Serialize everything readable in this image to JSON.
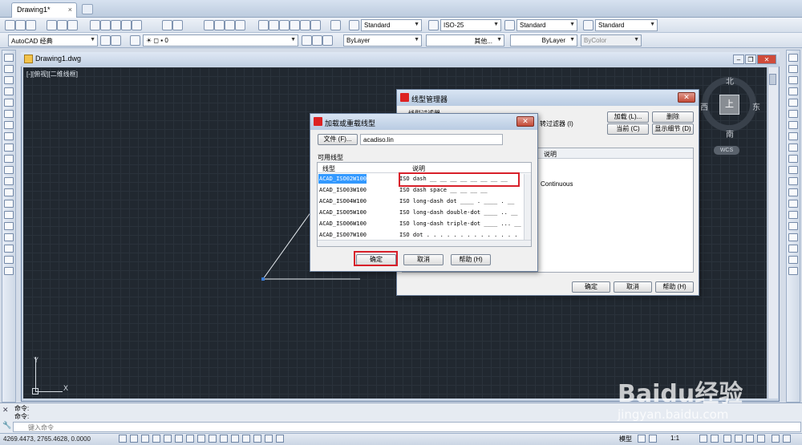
{
  "tabs": {
    "doc_tab": "Drawing1*",
    "close": "×"
  },
  "toolbar": {
    "text_style": "Standard",
    "dim_style": "ISO-25",
    "table_style": "Standard",
    "mleader_style": "Standard",
    "workspace": "AutoCAD 经典",
    "layer_value": "0",
    "color_value": "ByLayer",
    "linetype_value": "其他...",
    "lineweight_value": "ByLayer",
    "plotstyle_value": "ByColor"
  },
  "drawing": {
    "title": "Drawing1.dwg",
    "view_label": "[-][俯视][二维线框]",
    "viewcube": {
      "north": "北",
      "south": "南",
      "east": "东",
      "west": "西",
      "top": "上",
      "wcs": "WCS"
    },
    "ucs": {
      "x": "X",
      "y": "Y"
    }
  },
  "ltm": {
    "title": "线型管理器",
    "filter_label": "线型过滤器",
    "filter_suffix": "转过滤器 (I)",
    "load_button": "加载 (L)...",
    "delete_button": "删除",
    "current_button": "当前 (C)",
    "details_button": "显示细节 (D)",
    "desc_header": "说明",
    "continuous": "Continuous",
    "ok": "确定",
    "cancel": "取消",
    "help": "帮助 (H)"
  },
  "load": {
    "title": "加载或重载线型",
    "file_button": "文件 (F)...",
    "file_value": "acadiso.lin",
    "available": "可用线型",
    "col_linetype": "线型",
    "col_desc": "说明",
    "rows": [
      {
        "name": "ACAD_ISO02W100",
        "desc": "ISO dash __ __ __ __ __ __ __ __"
      },
      {
        "name": "ACAD_ISO03W100",
        "desc": "ISO dash space __   __   __   __"
      },
      {
        "name": "ACAD_ISO04W100",
        "desc": "ISO long-dash dot ____ . ____ . __"
      },
      {
        "name": "ACAD_ISO05W100",
        "desc": "ISO long-dash double-dot ____ .. __"
      },
      {
        "name": "ACAD_ISO06W100",
        "desc": "ISO long-dash triple-dot ____ ... __"
      },
      {
        "name": "ACAD_ISO07W100",
        "desc": "ISO dot . . . . . . . . . . . . . ."
      }
    ],
    "ok": "确定",
    "cancel": "取消",
    "help": "帮助 (H)"
  },
  "command": {
    "line1": "命令:",
    "line2": "命令:",
    "prompt": "键入命令"
  },
  "status": {
    "coords": "4269.4473, 2765.4628, 0.0000",
    "model": "模型",
    "scale": "1:1"
  },
  "watermark": {
    "logo": "Baidu经验",
    "url": "jingyan.baidu.com"
  },
  "colors": {
    "canvas": "#212830",
    "highlight": "#d8202a",
    "selected_row": "#3399ff"
  }
}
